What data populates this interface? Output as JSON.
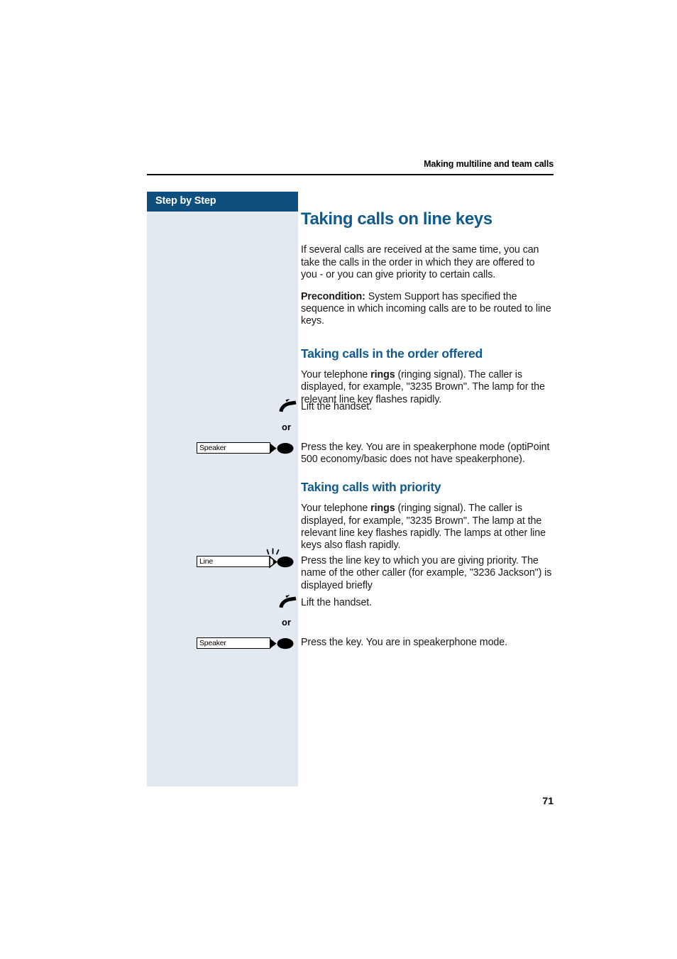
{
  "page": {
    "running_head": "Making multiline and team calls",
    "page_number": "71",
    "accent_color": "#115A8C",
    "header_bar_color": "#0e4f7d",
    "sidebar_color": "#e3e9f0"
  },
  "sidebar": {
    "title": "Step by Step"
  },
  "content": {
    "title": "Taking calls on line keys",
    "intro": "If several calls are received at the same time, you can take the calls in the order in which they are offered to you - or you can give priority to certain calls.",
    "precondition_label": "Precondition:",
    "precondition_text": " System Support has specified the sequence in which incoming calls are to be routed to line keys.",
    "sections": [
      {
        "heading": "Taking calls in the order offered",
        "paragraph": "Your telephone ",
        "paragraph_bold": "rings",
        "paragraph_rest": " (ringing signal). The caller is displayed, for example, \"3235 Brown\". The lamp for the relevant line key flashes rapidly."
      },
      {
        "heading": "Taking calls with priority",
        "paragraph": "Your telephone ",
        "paragraph_bold": "rings",
        "paragraph_rest": " (ringing signal). The caller is displayed, for example, \"3235 Brown\". The lamp at the relevant line key flashes rapidly. The lamps at other line keys also flash rapidly."
      }
    ],
    "steps": [
      {
        "icon": "handset-icon",
        "key_label": "",
        "text": "Lift the handset."
      },
      {
        "icon": "or-separator",
        "key_label": "",
        "text": "or"
      },
      {
        "icon": "speaker-key-icon",
        "key_label": "Speaker",
        "text": "Press the key. You are in speakerphone mode (optiPoint 500 economy/basic does not have speakerphone)."
      },
      {
        "icon": "line-key-icon",
        "key_label": "Line",
        "text": "Press the line key to which you are giving priority. The name of the other caller (for example, \"3236 Jackson\") is displayed briefly"
      },
      {
        "icon": "handset-icon",
        "key_label": "",
        "text": "Lift the handset."
      },
      {
        "icon": "or-separator",
        "key_label": "",
        "text": "or"
      },
      {
        "icon": "speaker-key-icon",
        "key_label": "Speaker",
        "text": "Press the key. You are in speakerphone mode."
      }
    ]
  }
}
